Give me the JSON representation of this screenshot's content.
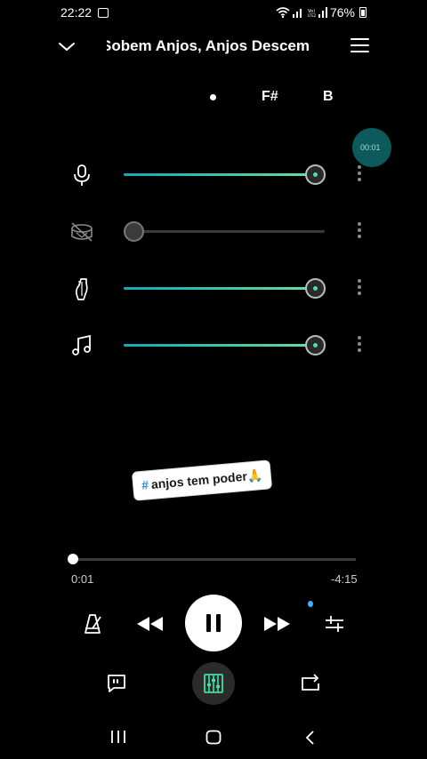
{
  "status": {
    "time": "22:22",
    "battery": "76%"
  },
  "header": {
    "title": "Sobem Anjos, Anjos Descem"
  },
  "chords": {
    "first": "F#",
    "second": "B"
  },
  "time_bubble": "00:01",
  "tracks": [
    {
      "icon": "microphone-icon",
      "level": 0.95
    },
    {
      "icon": "drum-icon",
      "level": 0.05
    },
    {
      "icon": "bass-guitar-icon",
      "level": 0.95
    },
    {
      "icon": "music-note-icon",
      "level": 0.95
    }
  ],
  "sticker": {
    "hash": "#",
    "text": "anjos tem poder🙏"
  },
  "playback": {
    "elapsed": "0:01",
    "remaining": "-4:15",
    "progress": 0.004
  },
  "colors": {
    "accent_start": "#1aa6b7",
    "accent_end": "#5fe3a1",
    "bubble": "#0c5a5c"
  }
}
